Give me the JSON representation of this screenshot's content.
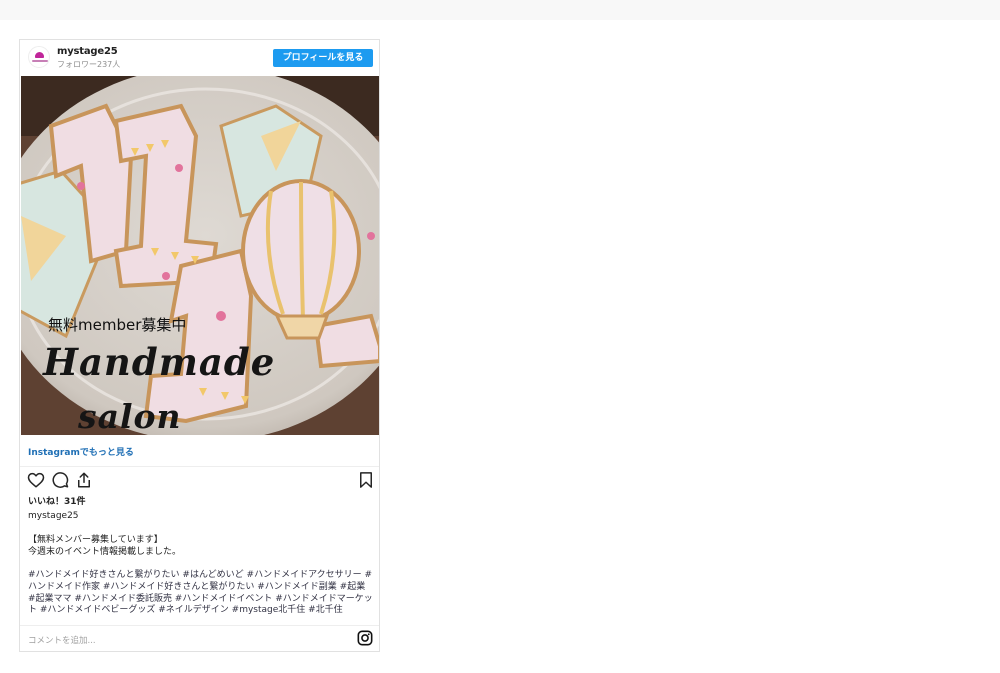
{
  "post": {
    "username": "mystage25",
    "followers": "フォロワー237人",
    "profile_button": "プロフィールを見る",
    "image_overlay": {
      "line1": "無料member募集中",
      "line2": "Handmade",
      "line3": "salon"
    },
    "more_link": "Instagramでもっと見る",
    "likes": "いいね！31件",
    "author": "mystage25",
    "caption_line1": "【無料メンバー募集しています】",
    "caption_line2": "今週末のイベント情報掲載しました。",
    "hashtags": "#ハンドメイド好きさんと繋がりたい #はんどめいど #ハンドメイドアクセサリー #ハンドメイド作家 #ハンドメイド好きさんと繋がりたい #ハンドメイド副業 #起業 #起業ママ #ハンドメイド委託販売 #ハンドメイドイベント #ハンドメイドマーケット #ハンドメイドベビーグッズ #ネイルデザイン #mystage北千住 #北千住",
    "comment_placeholder": "コメントを追加...",
    "icons": [
      "heart-icon",
      "comment-icon",
      "share-icon",
      "bookmark-icon",
      "instagram-icon"
    ]
  },
  "colors": {
    "button_blue": "#1d9bf0",
    "link_blue": "#1f6fb5",
    "border": "#e1e1e1"
  }
}
